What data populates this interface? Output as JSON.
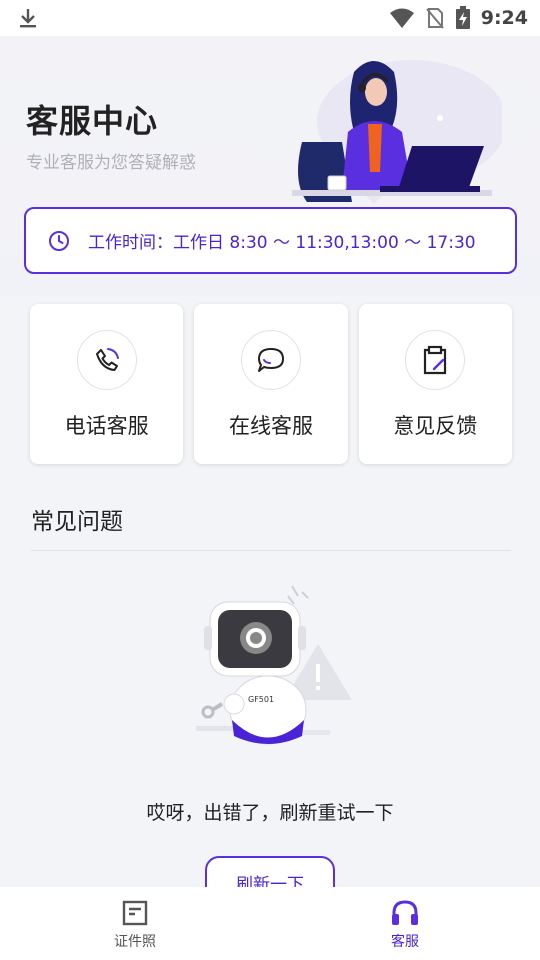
{
  "status_bar": {
    "time": "9:24"
  },
  "header": {
    "title": "客服中心",
    "subtitle": "专业客服为您答疑解惑"
  },
  "hours": {
    "text": "工作时间：工作日 8:30 ～ 11:30,13:00 ～ 17:30"
  },
  "services": [
    {
      "label": "电话客服",
      "icon": "phone-icon"
    },
    {
      "label": "在线客服",
      "icon": "chat-icon"
    },
    {
      "label": "意见反馈",
      "icon": "clipboard-edit-icon"
    }
  ],
  "faq": {
    "title": "常见问题",
    "error_text": "哎呀，出错了，刷新重试一下",
    "refresh_label": "刷新一下",
    "robot_badge": "GF501"
  },
  "tabbar": {
    "items": [
      {
        "label": "证件照",
        "icon": "document-icon",
        "active": false
      },
      {
        "label": "客服",
        "icon": "headset-icon",
        "active": true
      }
    ]
  },
  "colors": {
    "accent": "#5a2fe0",
    "accent_text": "#4b23d6",
    "background": "#f3f4f8"
  }
}
